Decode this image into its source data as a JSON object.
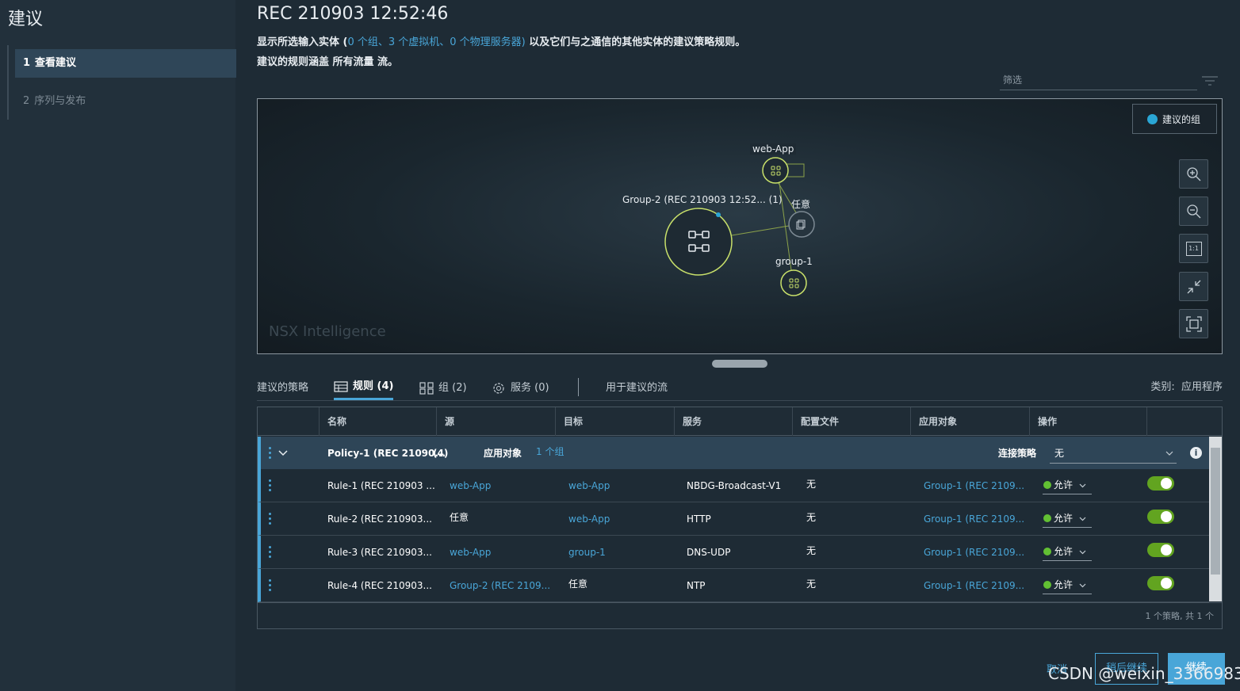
{
  "sidebar": {
    "title": "建议",
    "steps": [
      {
        "num": "1",
        "label": "查看建议"
      },
      {
        "num": "2",
        "label": "序列与发布"
      }
    ]
  },
  "header": {
    "title": "REC 210903 12:52:46",
    "desc_prefix": "显示所选输入实体 (",
    "desc_links": "0 个组、3 个虚拟机、0 个物理服务器)",
    "desc_suffix": " 以及它们与之通信的其他实体的建议策略规则。",
    "desc2": "建议的规则涵盖 所有流量 流。",
    "filter_placeholder": "筛选"
  },
  "graph": {
    "watermark": "NSX Intelligence",
    "suggest_groups_button": "建议的组",
    "nodes": {
      "web_app": "web-App",
      "group2": "Group-2 (REC 210903 12:52... (1)",
      "any": "任意",
      "group1": "group-1"
    },
    "tools": [
      "zoom-in",
      "zoom-out",
      "actual-size",
      "collapse",
      "fit-screen"
    ],
    "tool_actual_size_text": "1:1"
  },
  "tabs": {
    "policy": "建议的策略",
    "rules": "规则 (4)",
    "groups": "组 (2)",
    "services": "服务 (0)",
    "flows": "用于建议的流",
    "category_label": "类别:",
    "category_value": "应用程序"
  },
  "table": {
    "headers": [
      "名称",
      "源",
      "目标",
      "服务",
      "配置文件",
      "应用对象",
      "操作"
    ],
    "policy": {
      "name": "Policy-1 (REC 21090...",
      "count": "(4)",
      "applied_label": "应用对象",
      "applied_value": "1 个组",
      "conn_label": "连接策略",
      "conn_value": "无"
    },
    "rows": [
      {
        "name": "Rule-1 (REC 210903 ...",
        "source": "web-App",
        "target": "web-App",
        "service": "NBDG-Broadcast-V1",
        "profile": "无",
        "applied": "Group-1 (REC 2109...",
        "action": "允许"
      },
      {
        "name": "Rule-2 (REC 210903...",
        "source": "任意",
        "target": "web-App",
        "service": "HTTP",
        "profile": "无",
        "applied": "Group-1 (REC 2109...",
        "action": "允许"
      },
      {
        "name": "Rule-3 (REC 210903...",
        "source": "web-App",
        "target": "group-1",
        "service": "DNS-UDP",
        "profile": "无",
        "applied": "Group-1 (REC 2109...",
        "action": "允许"
      },
      {
        "name": "Rule-4 (REC 210903...",
        "source": "Group-2 (REC 2109...",
        "target": "任意",
        "service": "NTP",
        "profile": "无",
        "applied": "Group-1 (REC 2109...",
        "action": "允许"
      }
    ],
    "footer": "1 个策略, 共 1 个"
  },
  "buttons": {
    "cancel": "取消",
    "later": "稍后继续",
    "continue": "继续"
  },
  "watermark_text": "CSDN @weixin_33669839",
  "colors": {
    "accent": "#49a6d8",
    "node": "#c8e06a",
    "allow": "#62c033",
    "toggle": "#62a420"
  }
}
